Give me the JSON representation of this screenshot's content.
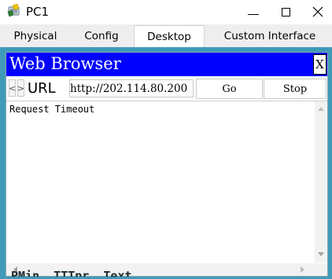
{
  "window": {
    "title": "PC1",
    "icon": "pc-icon",
    "controls": {
      "minimize": "—",
      "maximize": "☐",
      "close": "✕"
    }
  },
  "tabs": [
    {
      "label": "Physical",
      "active": false
    },
    {
      "label": "Config",
      "active": false
    },
    {
      "label": "Desktop",
      "active": true
    },
    {
      "label": "Custom Interface",
      "active": false
    }
  ],
  "browser": {
    "title": "Web Browser",
    "close_label": "X",
    "nav": {
      "back": "<",
      "forward": ">"
    },
    "url_label": "URL",
    "url_value": "http://202.114.80.200",
    "go_label": "Go",
    "stop_label": "Stop",
    "content_text": "Request Timeout",
    "underlying_text": "PMin  TTTpr  Text"
  },
  "colors": {
    "header_blue": "#0000ff",
    "panel_teal": "#3f9ab8",
    "tab_bar": "#eeeeee"
  }
}
